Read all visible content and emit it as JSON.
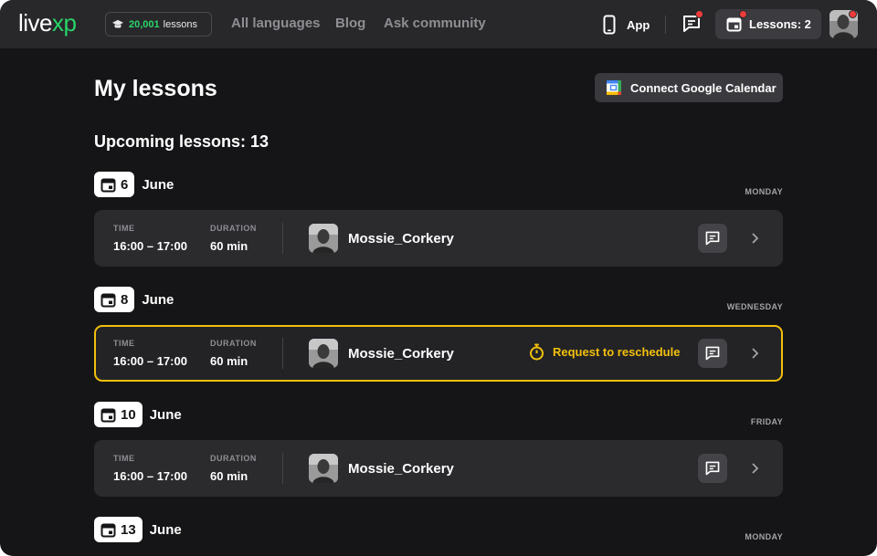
{
  "header": {
    "logo": {
      "main": "live",
      "accent": "xp"
    },
    "lessons_pill": {
      "count": "20,001",
      "label": "lessons"
    },
    "nav": [
      "All languages",
      "Blog",
      "Ask community"
    ],
    "app_label": "App",
    "lessons_button": "Lessons: 2"
  },
  "main": {
    "title": "My lessons",
    "gcal_button": "Connect Google Calendar",
    "upcoming": "Upcoming lessons: 13",
    "days": [
      {
        "day": "6",
        "month": "June",
        "weekday": "MONDAY",
        "lesson": {
          "time_label": "TIME",
          "time": "16:00 – 17:00",
          "duration_label": "DURATION",
          "duration": "60 min",
          "tutor": "Mossie_Corkery"
        }
      },
      {
        "day": "8",
        "month": "June",
        "weekday": "WEDNESDAY",
        "lesson": {
          "time_label": "TIME",
          "time": "16:00 – 17:00",
          "duration_label": "DURATION",
          "duration": "60 min",
          "tutor": "Mossie_Corkery",
          "status": "Request to reschedule"
        }
      },
      {
        "day": "10",
        "month": "June",
        "weekday": "FRIDAY",
        "lesson": {
          "time_label": "TIME",
          "time": "16:00 – 17:00",
          "duration_label": "DURATION",
          "duration": "60 min",
          "tutor": "Mossie_Corkery"
        }
      },
      {
        "day": "13",
        "month": "June",
        "weekday": "MONDAY"
      }
    ]
  },
  "colors": {
    "accent_green": "#2ad46a",
    "highlight_yellow": "#f2c00c",
    "notification_red": "#ee3b3b",
    "background": "#151517"
  },
  "icons": [
    "graduation-cap-icon",
    "phone-icon",
    "chat-icon",
    "calendar-icon",
    "google-calendar-icon",
    "stopwatch-icon",
    "chevron-right-icon"
  ]
}
